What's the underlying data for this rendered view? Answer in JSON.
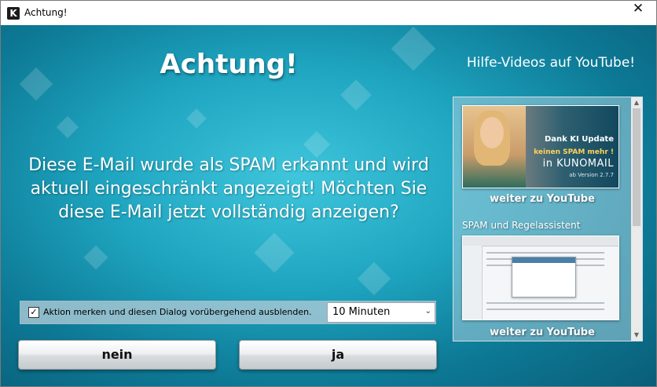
{
  "window": {
    "title": "Achtung!",
    "close_glyph": "✕",
    "app_icon_letter": "K"
  },
  "dialog": {
    "heading": "Achtung!",
    "message": "Diese E-Mail wurde als SPAM erkannt und wird aktuell eingeschränkt angezeigt! Möchten Sie diese E-Mail jetzt vollständig anzeigen?"
  },
  "help": {
    "title": "Hilfe-Videos auf YouTube!",
    "videos": [
      {
        "overlay_line1": "Dank KI Update",
        "overlay_line2": "keinen SPAM mehr !",
        "overlay_line3": "in KUNOMAIL",
        "overlay_line4": "ab Version 2.7.7",
        "link": "weiter zu YouTube"
      },
      {
        "title": "SPAM und Regelassistent",
        "link": "weiter zu YouTube"
      }
    ]
  },
  "options": {
    "remember_checked": true,
    "check_glyph": "✓",
    "remember_label": "Aktion merken und diesen Dialog vorübergehend ausblenden.",
    "duration_selected": "10 Minuten",
    "chevron_glyph": "⌄"
  },
  "buttons": {
    "no": "nein",
    "yes": "ja"
  },
  "colors": {
    "background_accent": "#1ea4bf",
    "button_face": "#e8ebec"
  },
  "icons": {
    "app": "kunomail-app-icon",
    "close": "close-icon",
    "check": "checkmark-icon",
    "dropdown": "chevron-down-icon"
  }
}
